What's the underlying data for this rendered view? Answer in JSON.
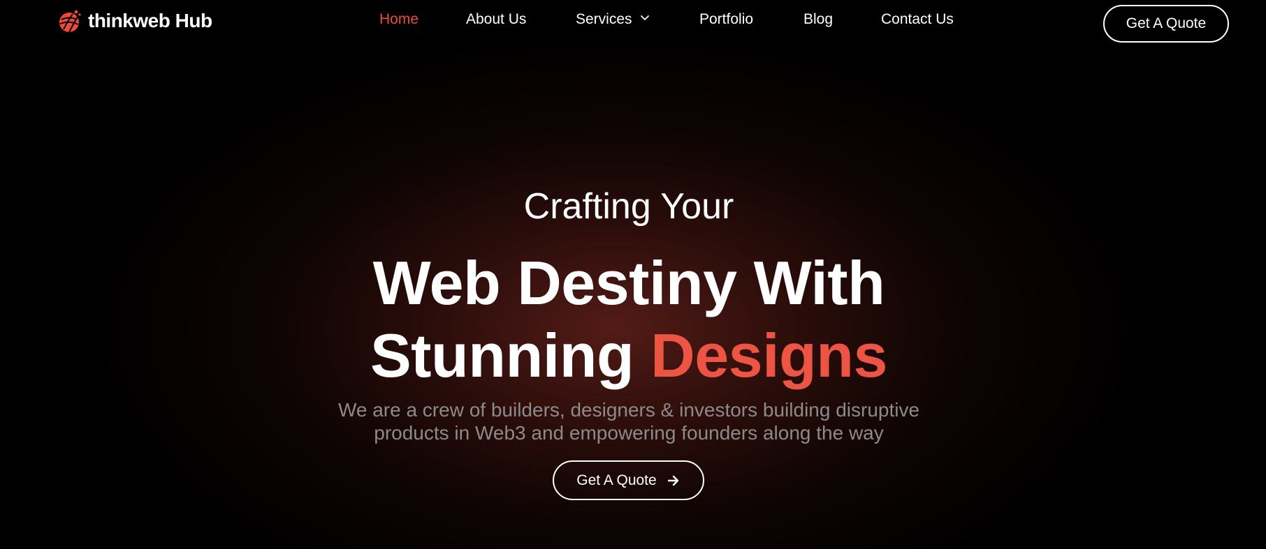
{
  "brand": {
    "name": "thinkweb Hub",
    "accent_color": "#ec4b3b",
    "logo_icon": "globe-logo-icon"
  },
  "nav": {
    "items": [
      {
        "label": "Home",
        "active": true
      },
      {
        "label": "About Us",
        "active": false
      },
      {
        "label": "Services",
        "active": false,
        "icon": "chevron-down-icon"
      },
      {
        "label": "Portfolio",
        "active": false
      },
      {
        "label": "Blog",
        "active": false
      },
      {
        "label": "Contact Us",
        "active": false
      }
    ]
  },
  "header": {
    "cta_label": "Get A Quote"
  },
  "hero": {
    "subtitle": "Crafting Your",
    "title_line1": "Web Destiny With",
    "title_line2_plain": "Stunning ",
    "title_line2_accent": "Designs",
    "description_line1": "We are a crew of builders, designers & investors building disruptive",
    "description_line2": "products in Web3 and empowering founders along the way",
    "cta_label": "Get A Quote",
    "cta_icon": "arrow-right-icon"
  }
}
